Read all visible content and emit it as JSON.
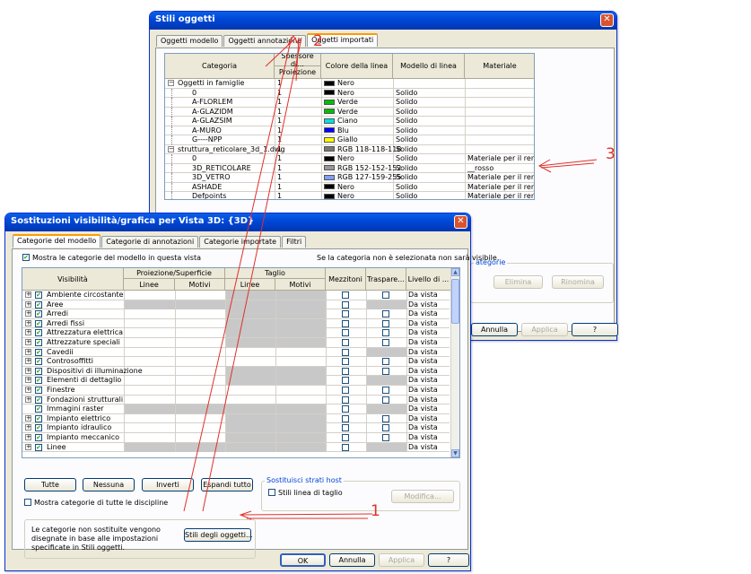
{
  "top_window": {
    "title": "Stili oggetti",
    "tabs": [
      "Oggetti modello",
      "Oggetti annotazione",
      "Oggetti importati"
    ],
    "headers": {
      "category": "Categoria",
      "thickness": "Spessore di...",
      "projection": "Proiezione",
      "line_color": "Colore della linea",
      "line_pattern": "Modello di linea",
      "material": "Materiale"
    },
    "rows": [
      {
        "name": "Oggetti in famiglie",
        "level": 0,
        "expand": "−",
        "thick": "1",
        "color": "#000000",
        "colorName": "Nero",
        "pattern": "",
        "material": ""
      },
      {
        "name": "0",
        "level": 1,
        "thick": "1",
        "color": "#000000",
        "colorName": "Nero",
        "pattern": "Solido",
        "material": ""
      },
      {
        "name": "A-FLORLEM",
        "level": 1,
        "thick": "1",
        "color": "#00c000",
        "colorName": "Verde",
        "pattern": "Solido",
        "material": ""
      },
      {
        "name": "A-GLAZIDM",
        "level": 1,
        "thick": "1",
        "color": "#00c000",
        "colorName": "Verde",
        "pattern": "Solido",
        "material": ""
      },
      {
        "name": "A-GLAZSIM",
        "level": 1,
        "thick": "1",
        "color": "#00e0e0",
        "colorName": "Ciano",
        "pattern": "Solido",
        "material": ""
      },
      {
        "name": "A-MURO",
        "level": 1,
        "thick": "1",
        "color": "#0000ff",
        "colorName": "Blu",
        "pattern": "Solido",
        "material": ""
      },
      {
        "name": "G----NPP",
        "level": 1,
        "thick": "1",
        "color": "#ffff00",
        "colorName": "Giallo",
        "pattern": "Solido",
        "material": ""
      },
      {
        "name": "struttura_reticolare_3d_1.dwg",
        "level": 0,
        "expand": "−",
        "thick": "1",
        "color": "#767676",
        "colorName": "RGB 118-118-118",
        "pattern": "Solido",
        "material": ""
      },
      {
        "name": "0",
        "level": 1,
        "thick": "1",
        "color": "#000000",
        "colorName": "Nero",
        "pattern": "Solido",
        "material": "Materiale per il rende..."
      },
      {
        "name": "3D_RETICOLARE",
        "level": 1,
        "thick": "1",
        "color": "#989898",
        "colorName": "RGB 152-152-152",
        "pattern": "Solido",
        "material": "__rosso"
      },
      {
        "name": "3D_VETRO",
        "level": 1,
        "thick": "1",
        "color": "#7f9fff",
        "colorName": "RGB 127-159-255",
        "pattern": "Solido",
        "material": "Materiale per il rende..."
      },
      {
        "name": "ASHADE",
        "level": 1,
        "thick": "1",
        "color": "#000000",
        "colorName": "Nero",
        "pattern": "Solido",
        "material": "Materiale per il rende..."
      },
      {
        "name": "Defpoints",
        "level": 1,
        "thick": "1",
        "color": "#000000",
        "colorName": "Nero",
        "pattern": "Solido",
        "material": "Materiale per il rende..."
      }
    ],
    "modify_group_label": "ategorie",
    "buttons": {
      "elimina": "Elimina",
      "rinomina": "Rinomina",
      "annulla": "Annulla",
      "applica": "Applica",
      "help": "?"
    }
  },
  "main_window": {
    "title": "Sostituzioni visibilità/grafica per Vista 3D: {3D}",
    "tabs": [
      "Categorie del modello",
      "Categorie di annotazioni",
      "Categorie importate",
      "Filtri"
    ],
    "show_categories_label": "Mostra le categorie del modello in questa vista",
    "info_text": "Se la categoria non è selezionata non sarà visibile.",
    "headers": {
      "visibility": "Visibilità",
      "proj_surface": "Proiezione/Superficie",
      "cut": "Taglio",
      "lines": "Linee",
      "patterns": "Motivi",
      "halftone": "Mezzitoni",
      "transparent": "Traspare...",
      "detail_level": "Livello di ..."
    },
    "rows": [
      {
        "name": "Ambiente circostante",
        "shade": [
          false,
          false,
          true,
          true
        ],
        "trans": true,
        "level": "Da vista"
      },
      {
        "name": "Aree",
        "shade": [
          true,
          true,
          true,
          true
        ],
        "trans": false,
        "level": "Da vista"
      },
      {
        "name": "Arredi",
        "shade": [
          false,
          false,
          true,
          true
        ],
        "trans": true,
        "level": "Da vista"
      },
      {
        "name": "Arredi fissi",
        "shade": [
          false,
          false,
          true,
          true
        ],
        "trans": true,
        "level": "Da vista"
      },
      {
        "name": "Attrezzatura elettrica",
        "shade": [
          false,
          false,
          true,
          true
        ],
        "trans": true,
        "level": "Da vista"
      },
      {
        "name": "Attrezzature speciali",
        "shade": [
          false,
          false,
          true,
          true
        ],
        "trans": true,
        "level": "Da vista"
      },
      {
        "name": "Cavedii",
        "shade": [
          false,
          false,
          false,
          false
        ],
        "trans": false,
        "level": "Da vista"
      },
      {
        "name": "Controsoffitti",
        "shade": [
          false,
          false,
          false,
          false
        ],
        "trans": true,
        "level": "Da vista"
      },
      {
        "name": "Dispositivi di illuminazione",
        "shade": [
          false,
          false,
          true,
          true
        ],
        "trans": true,
        "level": "Da vista"
      },
      {
        "name": "Elementi di dettaglio",
        "shade": [
          false,
          false,
          true,
          true
        ],
        "trans": false,
        "level": "Da vista"
      },
      {
        "name": "Finestre",
        "shade": [
          false,
          false,
          false,
          false
        ],
        "trans": true,
        "level": "Da vista"
      },
      {
        "name": "Fondazioni strutturali",
        "shade": [
          false,
          false,
          false,
          false
        ],
        "trans": true,
        "level": "Da vista"
      },
      {
        "name": "Immagini raster",
        "shade": [
          true,
          true,
          true,
          true
        ],
        "trans": false,
        "level": "Da vista",
        "noExpand": true
      },
      {
        "name": "Impianto elettrico",
        "shade": [
          false,
          false,
          true,
          true
        ],
        "trans": true,
        "level": "Da vista"
      },
      {
        "name": "Impianto idraulico",
        "shade": [
          false,
          false,
          true,
          true
        ],
        "trans": true,
        "level": "Da vista"
      },
      {
        "name": "Impianto meccanico",
        "shade": [
          false,
          false,
          true,
          true
        ],
        "trans": true,
        "level": "Da vista"
      },
      {
        "name": "Linee",
        "shade": [
          true,
          true,
          true,
          true
        ],
        "trans": false,
        "level": "Da vista"
      }
    ],
    "buttons": {
      "tutte": "Tutte",
      "nessuna": "Nessuna",
      "inverti": "Inverti",
      "espandi": "Espandi tutto",
      "modifica": "Modifica...",
      "stili": "Stili degli oggetti...",
      "ok": "OK",
      "annulla": "Annulla",
      "applica": "Applica",
      "help": "?"
    },
    "host_group_title": "Sostituisci strati host",
    "cut_line_styles_label": "Stili linea di taglio",
    "show_all_disciplines_label": "Mostra categorie di tutte le discipline",
    "note_text": "Le categorie non sostituite vengono disegnate in base alle impostazioni specificate in Stili oggetti."
  },
  "annotations": [
    "1",
    "2",
    "3"
  ],
  "colors": {
    "annotation": "#e0302a",
    "titlebar": "#0047d6",
    "dialog_bg": "#ece9d8"
  }
}
